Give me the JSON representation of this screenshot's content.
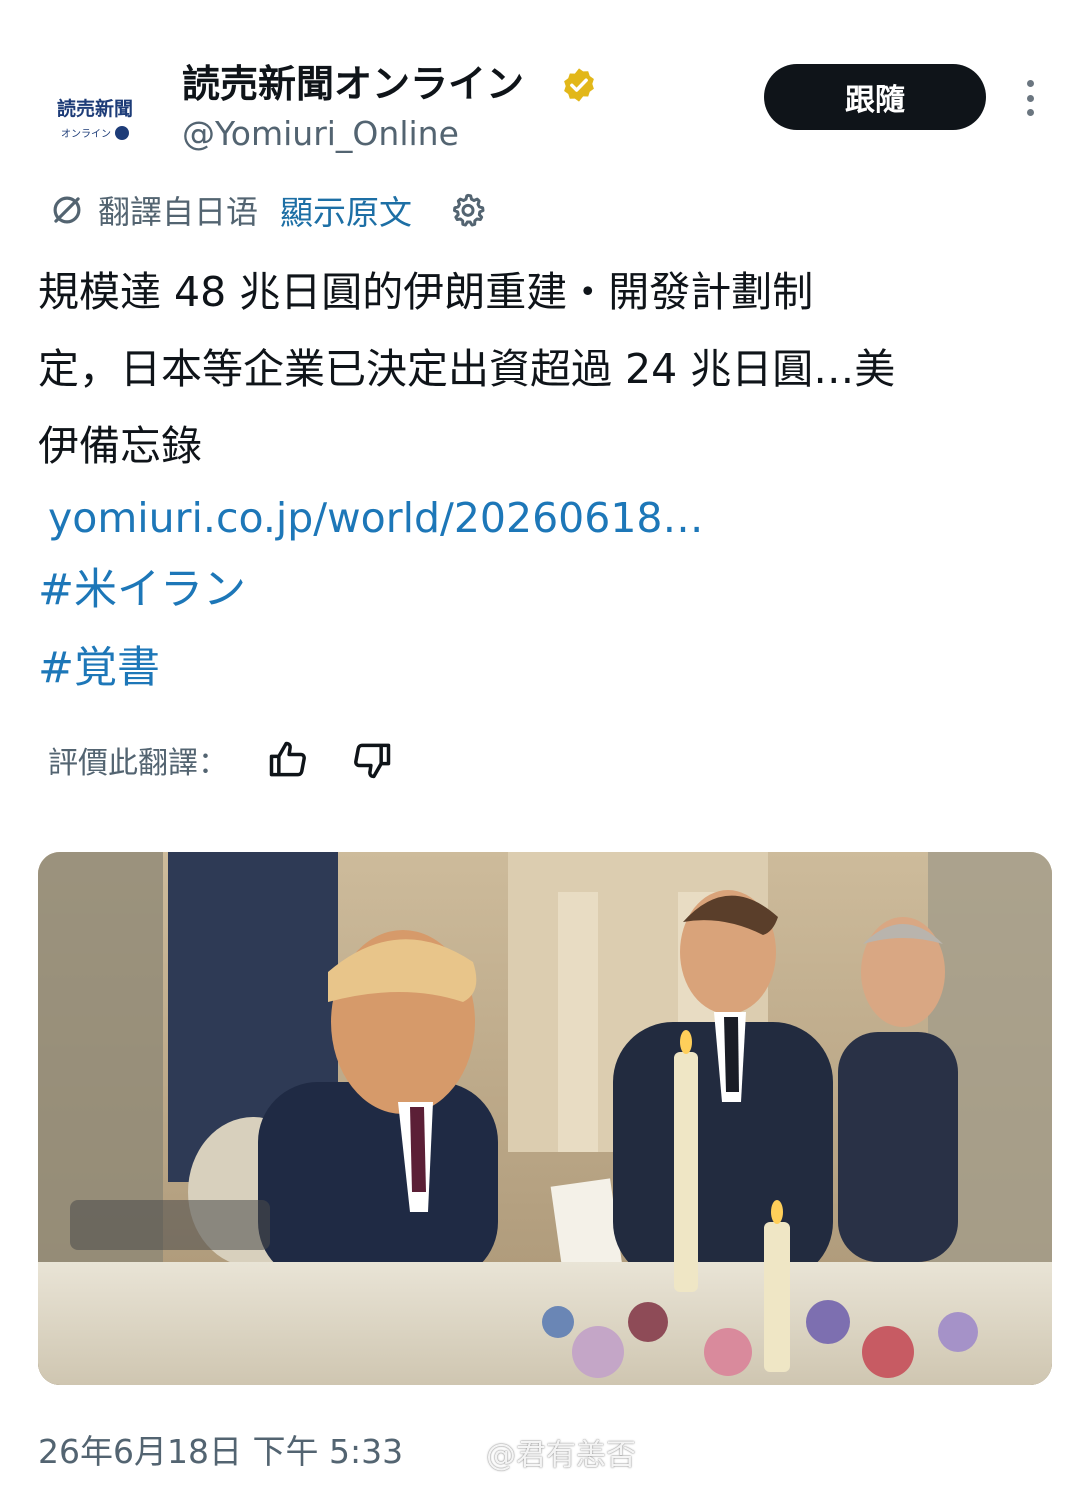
{
  "account": {
    "avatar_logo_text": "読売新聞",
    "avatar_logo_sub": "オンライン",
    "display_name": "読売新聞オンライン",
    "handle": "@Yomiuri_Online",
    "verified_badge": "verified-gold-icon",
    "follow_label": "跟隨"
  },
  "translation": {
    "notice": "翻譯自日语",
    "show_original": "顯示原文"
  },
  "tweet": {
    "lines": [
      "規模達 48 兆日圓的伊朗重建・開發計劃制",
      "定，日本等企業已決定出資超過 24 兆日圓…美",
      "伊備忘錄"
    ],
    "link": "yomiuri.co.jp/world/20260618…",
    "hashtags": [
      "#米イラン",
      "#覚書"
    ]
  },
  "rating": {
    "label": "評價此翻譯："
  },
  "timestamp": "26年6月18日 下午 5:33",
  "watermark": "@君有恙否",
  "colors": {
    "link": "#1d77b8",
    "follow_bg": "#0f1419",
    "secondary_text": "#536471",
    "verified_gold": "#e2b719"
  }
}
